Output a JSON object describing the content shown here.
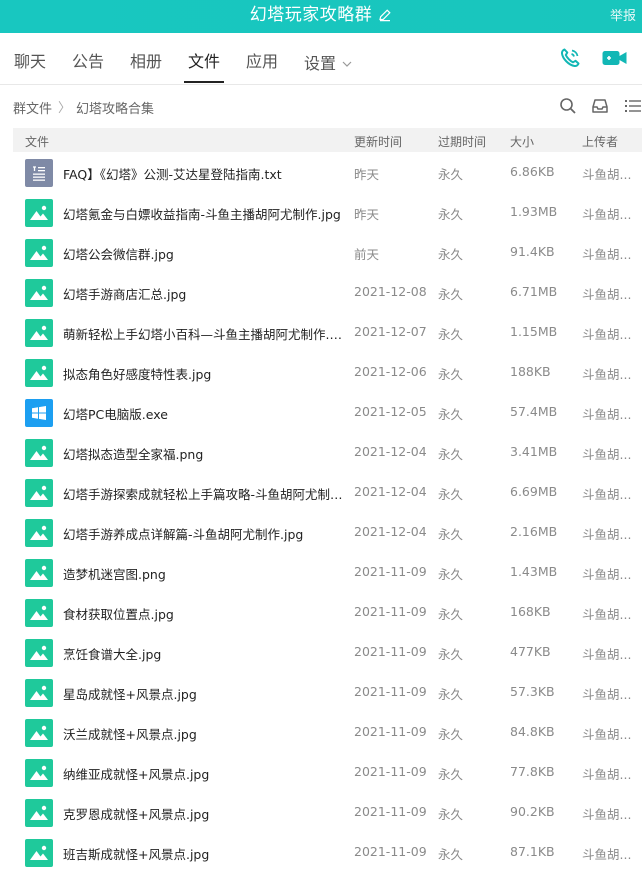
{
  "window": {
    "title": "幻塔玩家攻略群",
    "report": "举报"
  },
  "tabs": [
    {
      "label": "聊天"
    },
    {
      "label": "公告"
    },
    {
      "label": "相册"
    },
    {
      "label": "文件"
    },
    {
      "label": "应用"
    },
    {
      "label": "设置"
    }
  ],
  "active_tab": "文件",
  "breadcrumb": {
    "root": "群文件",
    "separator": "〉",
    "current": "幻塔攻略合集"
  },
  "columns": {
    "name": "文件",
    "time": "更新时间",
    "expire": "过期时间",
    "size": "大小",
    "uploader": "上传者"
  },
  "files": [
    {
      "name": "FAQ】《幻塔》公测-艾达星登陆指南.txt",
      "time": "昨天",
      "expire": "永久",
      "size": "6.86KB",
      "uploader": "斗鱼胡...",
      "icon": "txt"
    },
    {
      "name": "幻塔氪金与白嫖收益指南-斗鱼主播胡阿尤制作.jpg",
      "time": "昨天",
      "expire": "永久",
      "size": "1.93MB",
      "uploader": "斗鱼胡...",
      "icon": "img"
    },
    {
      "name": "幻塔公会微信群.jpg",
      "time": "前天",
      "expire": "永久",
      "size": "91.4KB",
      "uploader": "斗鱼胡...",
      "icon": "img"
    },
    {
      "name": "幻塔手游商店汇总.jpg",
      "time": "2021-12-08",
      "expire": "永久",
      "size": "6.71MB",
      "uploader": "斗鱼胡...",
      "icon": "img"
    },
    {
      "name": "萌新轻松上手幻塔小百科—斗鱼主播胡阿尤制作.jpg",
      "time": "2021-12-07",
      "expire": "永久",
      "size": "1.15MB",
      "uploader": "斗鱼胡...",
      "icon": "img"
    },
    {
      "name": "拟态角色好感度特性表.jpg",
      "time": "2021-12-06",
      "expire": "永久",
      "size": "188KB",
      "uploader": "斗鱼胡...",
      "icon": "img"
    },
    {
      "name": "幻塔PC电脑版.exe",
      "time": "2021-12-05",
      "expire": "永久",
      "size": "57.4MB",
      "uploader": "斗鱼胡...",
      "icon": "exe"
    },
    {
      "name": "幻塔拟态造型全家福.png",
      "time": "2021-12-04",
      "expire": "永久",
      "size": "3.41MB",
      "uploader": "斗鱼胡...",
      "icon": "img"
    },
    {
      "name": "幻塔手游探索成就轻松上手篇攻略-斗鱼胡阿尤制作.jpg",
      "time": "2021-12-04",
      "expire": "永久",
      "size": "6.69MB",
      "uploader": "斗鱼胡...",
      "icon": "img"
    },
    {
      "name": "幻塔手游养成点详解篇-斗鱼胡阿尤制作.jpg",
      "time": "2021-12-04",
      "expire": "永久",
      "size": "2.16MB",
      "uploader": "斗鱼胡...",
      "icon": "img"
    },
    {
      "name": "造梦机迷宫图.png",
      "time": "2021-11-09",
      "expire": "永久",
      "size": "1.43MB",
      "uploader": "斗鱼胡...",
      "icon": "img"
    },
    {
      "name": "食材获取位置点.jpg",
      "time": "2021-11-09",
      "expire": "永久",
      "size": "168KB",
      "uploader": "斗鱼胡...",
      "icon": "img"
    },
    {
      "name": "烹饪食谱大全.jpg",
      "time": "2021-11-09",
      "expire": "永久",
      "size": "477KB",
      "uploader": "斗鱼胡...",
      "icon": "img"
    },
    {
      "name": "星岛成就怪+风景点.jpg",
      "time": "2021-11-09",
      "expire": "永久",
      "size": "57.3KB",
      "uploader": "斗鱼胡...",
      "icon": "img"
    },
    {
      "name": "沃兰成就怪+风景点.jpg",
      "time": "2021-11-09",
      "expire": "永久",
      "size": "84.8KB",
      "uploader": "斗鱼胡...",
      "icon": "img"
    },
    {
      "name": "纳维亚成就怪+风景点.jpg",
      "time": "2021-11-09",
      "expire": "永久",
      "size": "77.8KB",
      "uploader": "斗鱼胡...",
      "icon": "img"
    },
    {
      "name": "克罗恩成就怪+风景点.jpg",
      "time": "2021-11-09",
      "expire": "永久",
      "size": "90.2KB",
      "uploader": "斗鱼胡...",
      "icon": "img"
    },
    {
      "name": "班吉斯成就怪+风景点.jpg",
      "time": "2021-11-09",
      "expire": "永久",
      "size": "87.1KB",
      "uploader": "斗鱼胡...",
      "icon": "img"
    }
  ],
  "colors": {
    "titlebar": "#18c7c0",
    "accent": "#12b7b5",
    "image_icon": "#1fc99b",
    "text_icon": "#7f8aa6",
    "exe_icon": "#1c9ff1"
  }
}
